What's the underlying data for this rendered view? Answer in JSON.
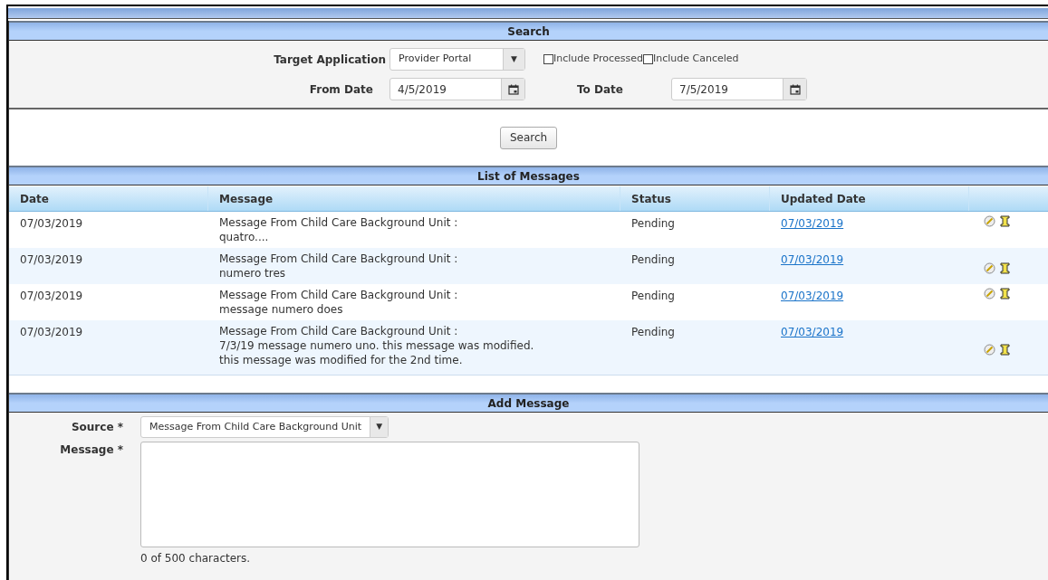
{
  "search": {
    "title": "Search",
    "target_application": {
      "label": "Target Application",
      "value": "Provider Portal",
      "arrow": "▼"
    },
    "checkboxes": [
      {
        "label": "Include Processed",
        "checked": false
      },
      {
        "label": "Include Canceled",
        "checked": false
      }
    ],
    "from_date": {
      "label": "From Date",
      "value": "4/5/2019"
    },
    "to_date": {
      "label": "To Date",
      "value": "7/5/2019"
    },
    "button": "Search"
  },
  "list": {
    "title": "List of Messages",
    "columns": [
      "Date",
      "Message",
      "Status",
      "Updated Date"
    ],
    "rows": [
      {
        "date": "07/03/2019",
        "message": "Message From Child Care Background Unit :\nquatro....",
        "status": "Pending",
        "updated": "07/03/2019"
      },
      {
        "date": "07/03/2019",
        "message": "Message From Child Care Background Unit :\nnumero tres",
        "status": "Pending",
        "updated": "07/03/2019"
      },
      {
        "date": "07/03/2019",
        "message": "Message From Child Care Background Unit :\nmessage numero does",
        "status": "Pending",
        "updated": "07/03/2019"
      },
      {
        "date": "07/03/2019",
        "message": "Message From Child Care Background Unit :\n7/3/19 message numero uno. this message was modified. this message was modified for the 2nd time.",
        "status": "Pending",
        "updated": "07/03/2019"
      }
    ]
  },
  "add": {
    "title": "Add Message",
    "source": {
      "label": "Source *",
      "value": "Message From Child Care Background Unit",
      "arrow": "▼"
    },
    "message": {
      "label": "Message *"
    },
    "counter": "0 of 500 characters."
  }
}
